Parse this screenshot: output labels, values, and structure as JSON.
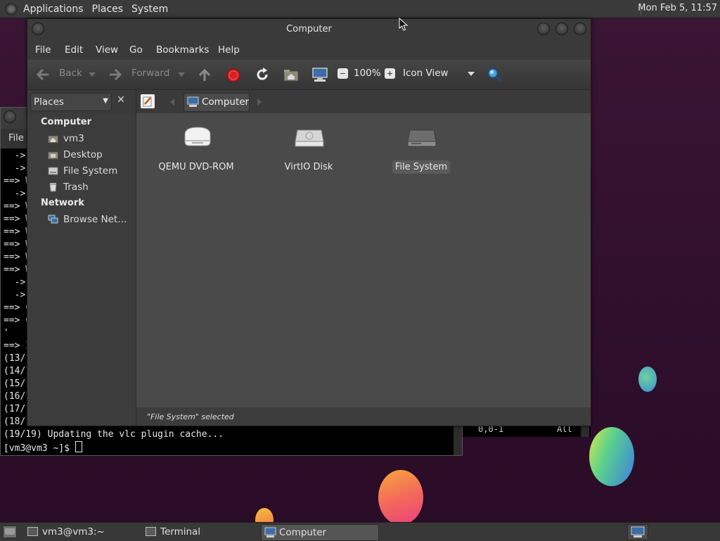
{
  "top_panel": {
    "menus": [
      "Applications",
      "Places",
      "System"
    ],
    "clock": "Mon Feb  5, 11:57"
  },
  "terminal": {
    "menu_file": "File",
    "lines": [
      "  ->",
      "  ->",
      "==> W",
      "  ->",
      "==> W",
      "==> W",
      "==> W",
      "==> W",
      "==> W",
      "==> W",
      "  ->",
      "  ->",
      "==> C",
      "==> C",
      "'",
      "==> I",
      "(13/1",
      "(14/1",
      "(15/1",
      "(16/1",
      "(17/1",
      "(18/1",
      "(19/19) Updating the vlc plugin cache..."
    ],
    "prompt": "[vm3@vm3 ~]$ "
  },
  "vim_status": {
    "position": "0,0-1",
    "scroll": "All"
  },
  "file_manager": {
    "title": "Computer",
    "menu": [
      "File",
      "Edit",
      "View",
      "Go",
      "Bookmarks",
      "Help"
    ],
    "toolbar": {
      "back": "Back",
      "forward": "Forward",
      "zoom": "100%",
      "view_mode": "Icon View"
    },
    "sidebar": {
      "selector": "Places",
      "sections": [
        {
          "heading": "Computer",
          "items": [
            "vm3",
            "Desktop",
            "File System",
            "Trash"
          ]
        },
        {
          "heading": "Network",
          "items": [
            "Browse Net…"
          ]
        }
      ]
    },
    "path": "Computer",
    "items": [
      {
        "label": "QEMU DVD-ROM",
        "icon": "optical-drive-icon"
      },
      {
        "label": "VirtIO Disk",
        "icon": "hard-disk-icon"
      },
      {
        "label": "File System",
        "icon": "filesystem-drive-icon",
        "selected": true
      }
    ],
    "status": "\"File System\" selected"
  },
  "taskbar": {
    "tasks": [
      {
        "label": "vm3@vm3:~",
        "active": false
      },
      {
        "label": "Terminal",
        "active": false
      },
      {
        "label": "Computer",
        "active": true
      }
    ]
  },
  "colors": {
    "selection": "#5a5a5a",
    "stop_red": "#d42020",
    "search_blue": "#4aa3df"
  }
}
